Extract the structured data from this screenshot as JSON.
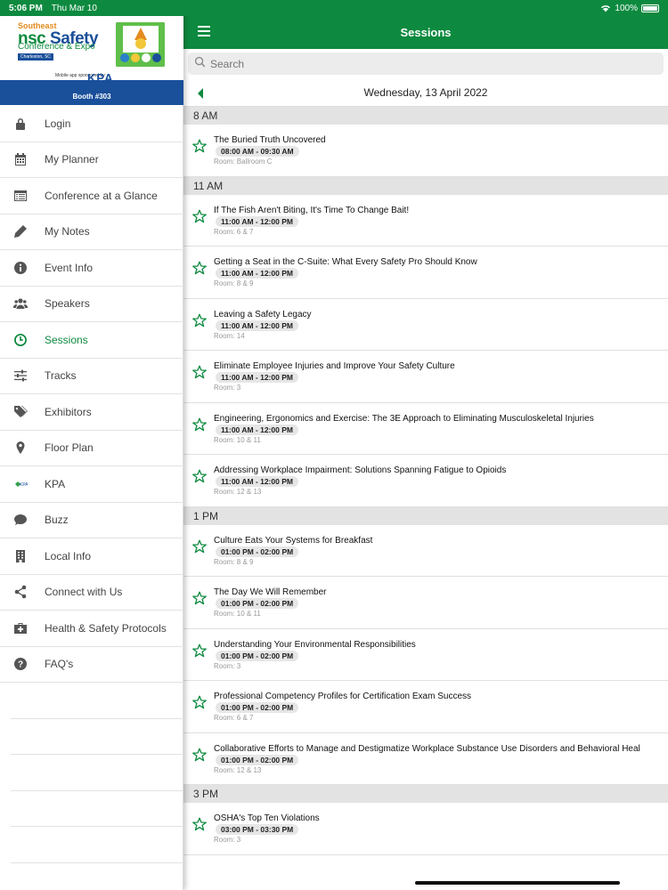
{
  "status_bar": {
    "time": "5:06 PM",
    "date": "Thu Mar 10",
    "battery": "100%"
  },
  "banner": {
    "brand_line1": "Southeast",
    "brand_line2a": "nsc",
    "brand_line2b": "Safety",
    "brand_line3": "Conference & Expo",
    "brand_line4": "Charleston, SC",
    "sponsor_label": "Mobile app sponsored by:",
    "sponsor": "KPA",
    "booth": "Booth #303"
  },
  "sidebar": {
    "items": [
      {
        "label": "Login",
        "icon": "lock-icon"
      },
      {
        "label": "My Planner",
        "icon": "calendar-icon"
      },
      {
        "label": "Conference at a Glance",
        "icon": "list-icon"
      },
      {
        "label": "My Notes",
        "icon": "pencil-icon"
      },
      {
        "label": "Event Info",
        "icon": "info-icon"
      },
      {
        "label": "Speakers",
        "icon": "people-icon"
      },
      {
        "label": "Sessions",
        "icon": "clock-icon",
        "active": true
      },
      {
        "label": "Tracks",
        "icon": "sliders-icon"
      },
      {
        "label": "Exhibitors",
        "icon": "tags-icon"
      },
      {
        "label": "Floor Plan",
        "icon": "map-pin-icon"
      },
      {
        "label": "KPA",
        "icon": "kpa-logo-icon"
      },
      {
        "label": "Buzz",
        "icon": "chat-bubble-icon"
      },
      {
        "label": "Local Info",
        "icon": "building-icon"
      },
      {
        "label": "Connect with Us",
        "icon": "share-icon"
      },
      {
        "label": "Health & Safety Protocols",
        "icon": "medkit-icon"
      },
      {
        "label": "FAQ's",
        "icon": "question-icon"
      }
    ]
  },
  "header": {
    "title": "Sessions"
  },
  "search": {
    "placeholder": "Search"
  },
  "date_nav": {
    "date": "Wednesday, 13 April 2022"
  },
  "groups": [
    {
      "heading": "8 AM",
      "sessions": [
        {
          "title": "The Buried Truth Uncovered",
          "time": "08:00 AM - 09:30 AM",
          "room": "Ballroom C"
        }
      ]
    },
    {
      "heading": "11 AM",
      "sessions": [
        {
          "title": "If The Fish Aren't Biting, It's Time To Change Bait!",
          "time": "11:00 AM - 12:00 PM",
          "room": "6 & 7"
        },
        {
          "title": "Getting a Seat in the C-Suite: What Every Safety Pro Should Know",
          "time": "11:00 AM - 12:00 PM",
          "room": "8 & 9"
        },
        {
          "title": "Leaving a Safety Legacy",
          "time": "11:00 AM - 12:00 PM",
          "room": "14"
        },
        {
          "title": "Eliminate Employee Injuries and Improve Your Safety Culture",
          "time": "11:00 AM - 12:00 PM",
          "room": "3"
        },
        {
          "title": "Engineering, Ergonomics and Exercise: The 3E Approach to Eliminating Musculoskeletal Injuries",
          "time": "11:00 AM - 12:00 PM",
          "room": "10 & 11"
        },
        {
          "title": "Addressing Workplace Impairment: Solutions Spanning Fatigue to Opioids",
          "time": "11:00 AM - 12:00 PM",
          "room": "12 & 13"
        }
      ]
    },
    {
      "heading": "1 PM",
      "sessions": [
        {
          "title": "Culture Eats Your Systems for Breakfast",
          "time": "01:00 PM - 02:00 PM",
          "room": "8 & 9"
        },
        {
          "title": "The Day We Will Remember",
          "time": "01:00 PM - 02:00 PM",
          "room": "10 & 11"
        },
        {
          "title": "Understanding Your Environmental Responsibilities",
          "time": "01:00 PM - 02:00 PM",
          "room": "3"
        },
        {
          "title": "Professional Competency Profiles for Certification Exam Success",
          "time": "01:00 PM - 02:00 PM",
          "room": "6 & 7"
        },
        {
          "title": "Collaborative Efforts to Manage and Destigmatize Workplace Substance Use Disorders and Behavioral Heal",
          "time": "01:00 PM - 02:00 PM",
          "room": "12 & 13"
        }
      ]
    },
    {
      "heading": "3 PM",
      "sessions": [
        {
          "title": "OSHA's Top Ten Violations",
          "time": "03:00 PM - 03:30 PM",
          "room": "3"
        }
      ]
    }
  ],
  "room_prefix": "Room:",
  "colors": {
    "brand_green": "#0d8a3f",
    "brand_blue": "#1a4f9a",
    "accent_orange": "#e58b1f"
  }
}
